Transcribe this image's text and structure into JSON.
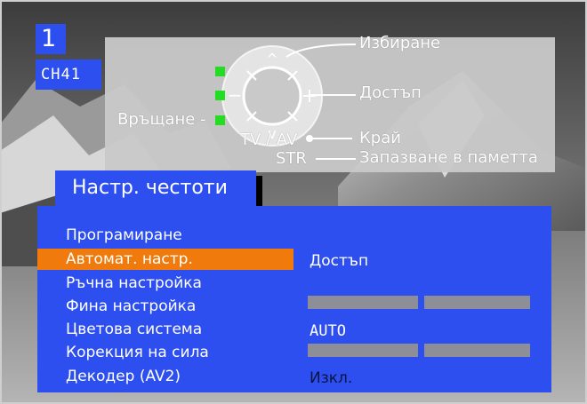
{
  "channel": {
    "number": "1",
    "name": "CH41"
  },
  "help": {
    "select": "Избиране",
    "access": "Достъп",
    "back": "Връщане -",
    "tvav": "TV / AV",
    "exit": "Край",
    "store_key": "STR",
    "store": "Запазване в паметта"
  },
  "menu": {
    "title": "Настр. честоти",
    "items": [
      {
        "label": "Програмиране"
      },
      {
        "label": "Автомат. настр.",
        "value": "Достъп",
        "selected": true
      },
      {
        "label": "Ръчна настройка"
      },
      {
        "label": "Фина настройка"
      },
      {
        "label": "Цветова система",
        "value": "AUTO"
      },
      {
        "label": "Корекция на сила"
      },
      {
        "label": "Декодер   (AV2)",
        "value": "Изкл."
      }
    ]
  },
  "colors": {
    "panel": "#2e4ff0",
    "highlight": "#f07a0c",
    "help_bg": "#c9c9c9",
    "indicator": "#22dd22",
    "bar": "#8e8e98"
  }
}
